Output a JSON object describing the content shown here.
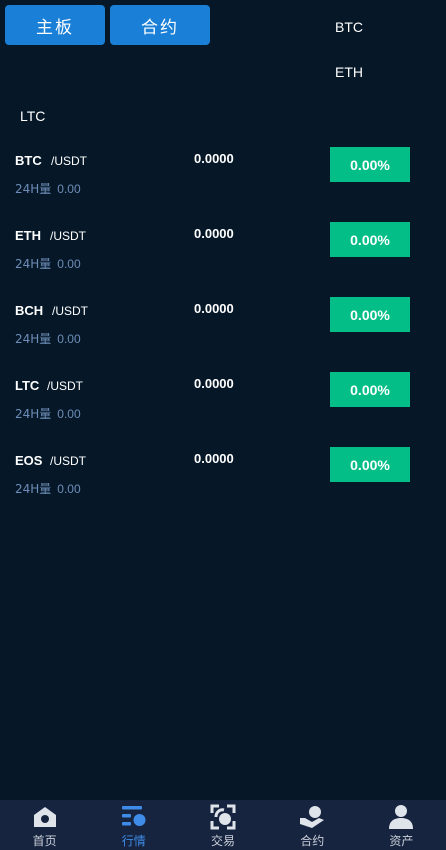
{
  "tabs": {
    "main_label": "主板",
    "contract_label": "合约"
  },
  "labels": {
    "btc": "BTC",
    "eth": "ETH",
    "ltc": "LTC"
  },
  "markets": [
    {
      "symbol": "BTC",
      "pair": "/USDT",
      "vol_label": "24H量",
      "vol_value": "0.00",
      "price": "0.0000",
      "change": "0.00%"
    },
    {
      "symbol": "ETH",
      "pair": "/USDT",
      "vol_label": "24H量",
      "vol_value": "0.00",
      "price": "0.0000",
      "change": "0.00%"
    },
    {
      "symbol": "BCH",
      "pair": "/USDT",
      "vol_label": "24H量",
      "vol_value": "0.00",
      "price": "0.0000",
      "change": "0.00%"
    },
    {
      "symbol": "LTC",
      "pair": "/USDT",
      "vol_label": "24H量",
      "vol_value": "0.00",
      "price": "0.0000",
      "change": "0.00%"
    },
    {
      "symbol": "EOS",
      "pair": "/USDT",
      "vol_label": "24H量",
      "vol_value": "0.00",
      "price": "0.0000",
      "change": "0.00%"
    }
  ],
  "nav": [
    {
      "label": "首页",
      "icon": "home-icon",
      "active": false
    },
    {
      "label": "行情",
      "icon": "market-icon",
      "active": true
    },
    {
      "label": "交易",
      "icon": "trade-icon",
      "active": false
    },
    {
      "label": "合约",
      "icon": "contract-icon",
      "active": false
    },
    {
      "label": "资产",
      "icon": "assets-icon",
      "active": false
    }
  ],
  "colors": {
    "background": "#061828",
    "tab_button": "#1a7fd6",
    "change_positive": "#03be87",
    "nav_bg": "#16243f",
    "nav_active": "#3f8ce8",
    "volume_text": "#6d8db8"
  }
}
